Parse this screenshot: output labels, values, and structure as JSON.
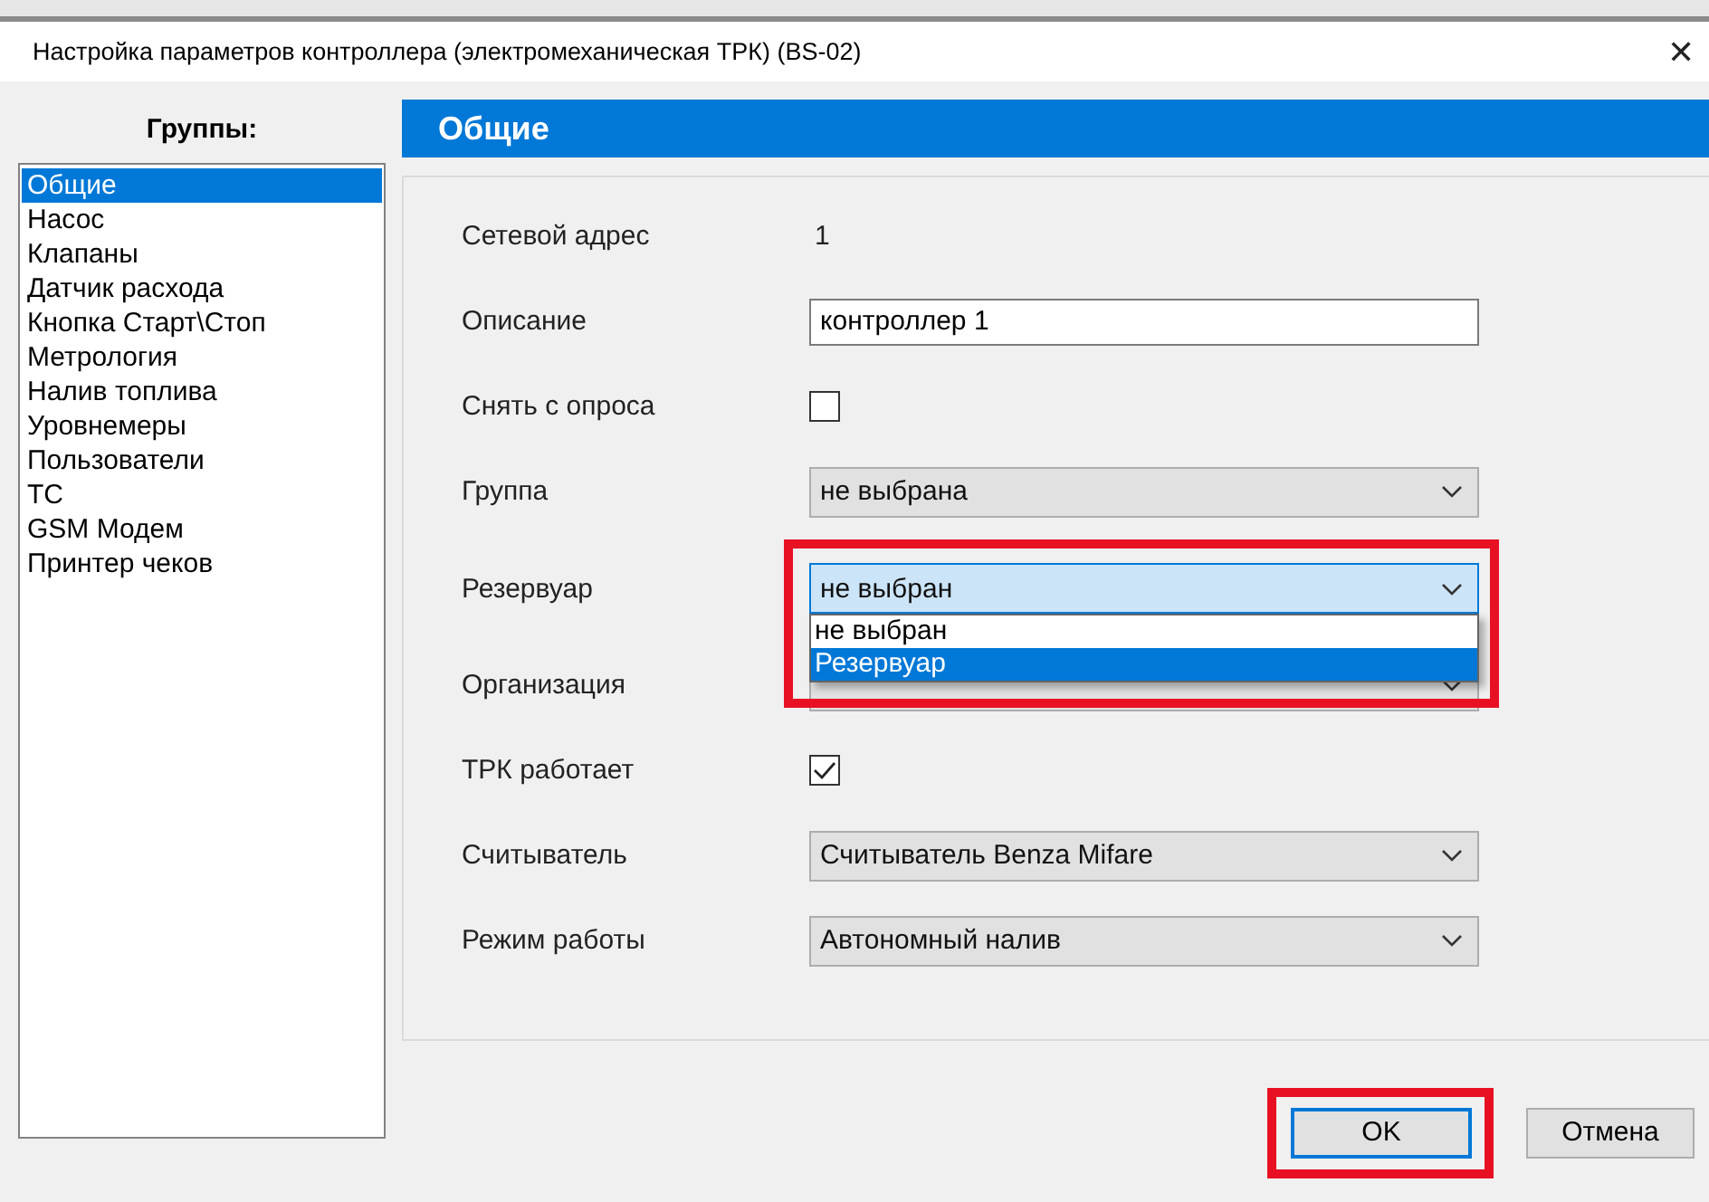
{
  "window": {
    "title": "Настройка параметров контроллера (электромеханическая ТРК) (BS-02)",
    "close": "✕"
  },
  "groups": {
    "heading": "Группы:",
    "items": [
      {
        "label": "Общие",
        "selected": true
      },
      {
        "label": "Насос",
        "selected": false
      },
      {
        "label": "Клапаны",
        "selected": false
      },
      {
        "label": "Датчик расхода",
        "selected": false
      },
      {
        "label": "Кнопка Старт\\Стоп",
        "selected": false
      },
      {
        "label": "Метрология",
        "selected": false
      },
      {
        "label": "Налив топлива",
        "selected": false
      },
      {
        "label": "Уровнемеры",
        "selected": false
      },
      {
        "label": "Пользователи",
        "selected": false
      },
      {
        "label": "ТС",
        "selected": false
      },
      {
        "label": "GSM Модем",
        "selected": false
      },
      {
        "label": "Принтер чеков",
        "selected": false
      }
    ]
  },
  "section": {
    "title": "Общие",
    "fields": [
      {
        "kind": "text",
        "label": "Сетевой адрес",
        "value": "1"
      },
      {
        "kind": "input",
        "label": "Описание",
        "value": "контроллер 1"
      },
      {
        "kind": "checkbox",
        "label": "Снять с опроса",
        "checked": false
      },
      {
        "kind": "combo",
        "label": "Группа",
        "value": "не выбрана"
      },
      {
        "kind": "combo",
        "label": "Резервуар",
        "value": "не выбран",
        "focused": true,
        "highlighted": true,
        "options": [
          {
            "label": "не выбран",
            "highlighted": false
          },
          {
            "label": "Резервуар",
            "highlighted": true
          }
        ]
      },
      {
        "kind": "combo",
        "label": "Организация"
      },
      {
        "kind": "checkbox",
        "label": "ТРК работает",
        "checked": true
      },
      {
        "kind": "combo",
        "label": "Считыватель",
        "value": "Считыватель Benza Mifare"
      },
      {
        "kind": "combo",
        "label": "Режим работы",
        "value": "Автономный налив"
      }
    ]
  },
  "buttons": [
    {
      "label": "OK",
      "default": true,
      "highlighted": true
    },
    {
      "label": "Отмена",
      "default": false,
      "highlighted": false
    }
  ]
}
